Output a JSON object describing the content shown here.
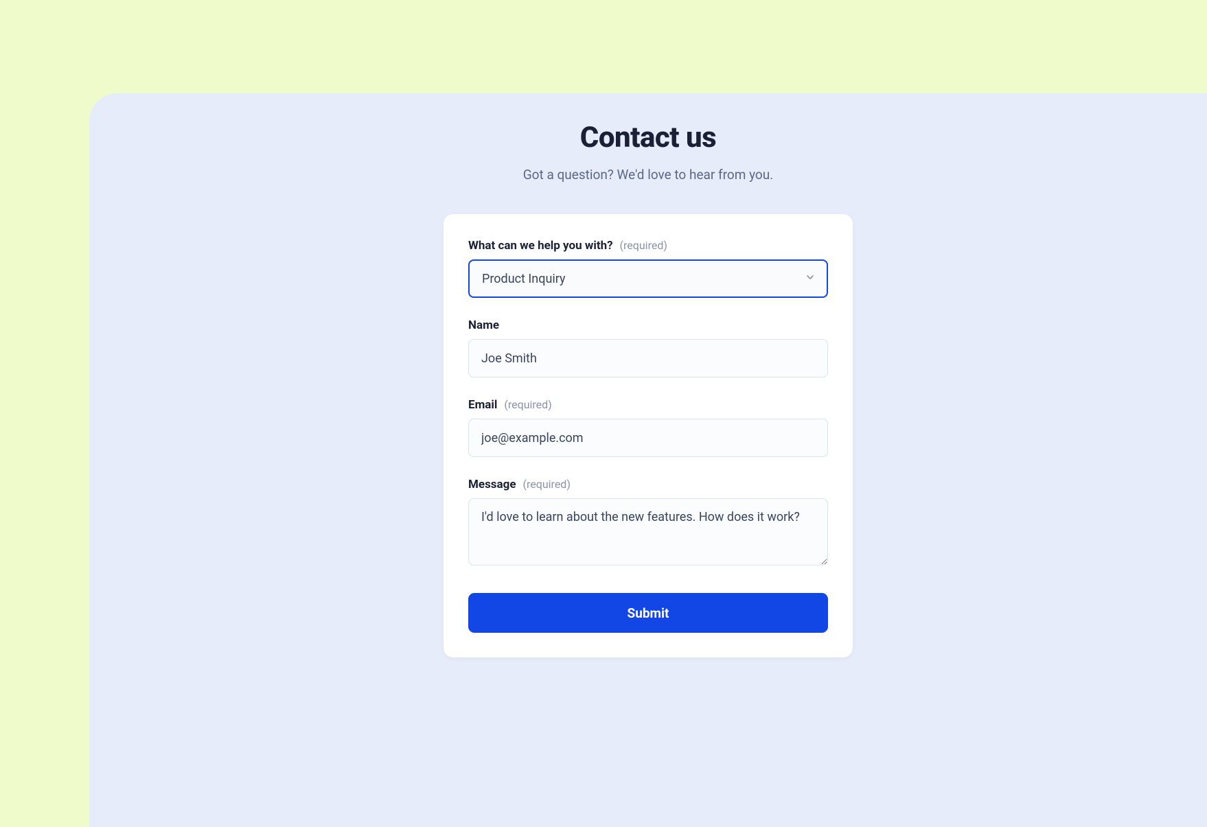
{
  "header": {
    "title": "Contact us",
    "subtitle": "Got a question? We'd love to hear from you."
  },
  "form": {
    "required_hint": "(required)",
    "topic": {
      "label": "What can we help you with?",
      "value": "Product Inquiry"
    },
    "name": {
      "label": "Name",
      "value": "Joe Smith"
    },
    "email": {
      "label": "Email",
      "value": "joe@example.com"
    },
    "message": {
      "label": "Message",
      "value": "I'd love to learn about the new features. How does it work?"
    },
    "submit_label": "Submit"
  }
}
